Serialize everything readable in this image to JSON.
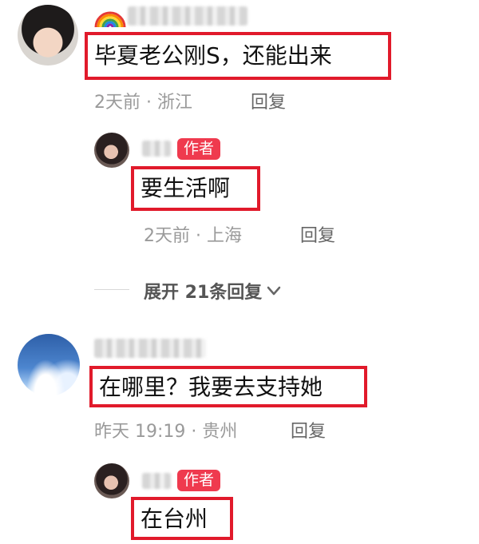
{
  "comments": [
    {
      "text": "毕夏老公刚S，还能出来",
      "meta": "2天前 · 浙江",
      "reply_label": "回复",
      "replies": [
        {
          "badge": "作者",
          "text": "要生活啊",
          "meta": "2天前 · 上海",
          "reply_label": "回复"
        }
      ],
      "expand_label": "展开 21条回复"
    },
    {
      "text": "在哪里？我要去支持她",
      "meta": "昨天 19:19 · 贵州",
      "reply_label": "回复",
      "replies": [
        {
          "badge": "作者",
          "text": "在台州"
        }
      ]
    }
  ],
  "icons": {
    "rainbow": "rainbow-icon",
    "chevron": "chevron-down-icon"
  },
  "colors": {
    "highlight_border": "#e11a2b",
    "author_badge": "#ef3a4e",
    "meta_text": "#9a9a9a"
  }
}
